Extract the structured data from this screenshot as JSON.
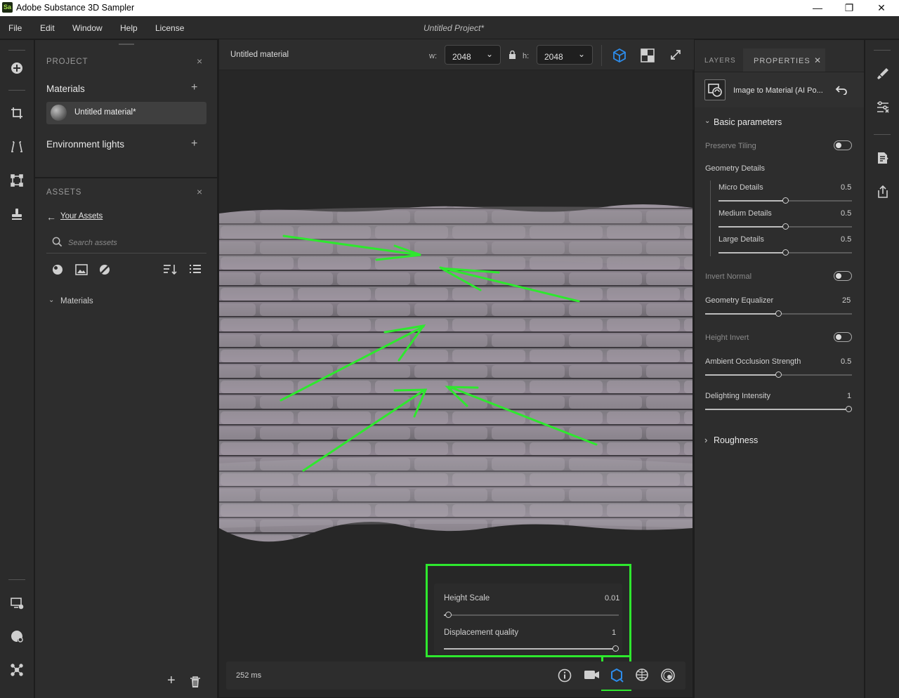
{
  "app": {
    "title": "Adobe Substance 3D Sampler",
    "logo_text": "Sa",
    "project_title": "Untitled Project*"
  },
  "window_controls": {
    "minimize": "—",
    "maximize": "❐",
    "close": "✕"
  },
  "menu": [
    "File",
    "Edit",
    "Window",
    "Help",
    "License"
  ],
  "left_toolbar": [
    "add-icon",
    "crop-icon",
    "perspective-icon",
    "transform-icon",
    "stamp-icon",
    "display-settings-icon",
    "palette-gear-icon",
    "network-icon"
  ],
  "project_panel": {
    "title": "PROJECT",
    "materials_label": "Materials",
    "material_item": "Untitled material*",
    "env_lights_label": "Environment lights",
    "add": "+",
    "close": "×"
  },
  "assets_panel": {
    "title": "ASSETS",
    "back_link": "Your Assets",
    "search_placeholder": "Search assets",
    "folder_label": "Materials",
    "close": "×",
    "add": "+"
  },
  "viewport": {
    "material_name": "Untitled material",
    "w_label": "w:",
    "w_value": "2048",
    "h_label": "h:",
    "h_value": "2048",
    "render_time": "252 ms",
    "popup": {
      "height_scale_label": "Height Scale",
      "height_scale_value": "0.01",
      "height_scale_level": 0.01,
      "displacement_label": "Displacement quality",
      "displacement_value": "1",
      "displacement_level": 1.0
    }
  },
  "right_panel": {
    "tabs": [
      "LAYERS",
      "PROPERTIES"
    ],
    "close": "✕",
    "layer_name": "Image to Material (AI Po...",
    "basic_params_label": "Basic parameters",
    "params": {
      "preserve_tiling": "Preserve Tiling",
      "geometry_details": "Geometry Details",
      "micro": {
        "label": "Micro Details",
        "value": "0.5",
        "level": 0.5
      },
      "medium": {
        "label": "Medium Details",
        "value": "0.5",
        "level": 0.5
      },
      "large": {
        "label": "Large Details",
        "value": "0.5",
        "level": 0.5
      },
      "invert_normal": "Invert Normal",
      "geo_equalizer": {
        "label": "Geometry Equalizer",
        "value": "25",
        "level": 0.5
      },
      "height_invert": "Height Invert",
      "ao_strength": {
        "label": "Ambient Occlusion Strength",
        "value": "0.5",
        "level": 0.5
      },
      "delighting": {
        "label": "Delighting Intensity",
        "value": "1",
        "level": 1.0
      }
    },
    "roughness_label": "Roughness"
  },
  "right_toolbar": [
    "paint-brush-icon",
    "sliders-icon",
    "document-edit-icon",
    "export-icon"
  ],
  "colors": {
    "annotation": "#2ee82e",
    "accent": "#2d8ceb"
  }
}
